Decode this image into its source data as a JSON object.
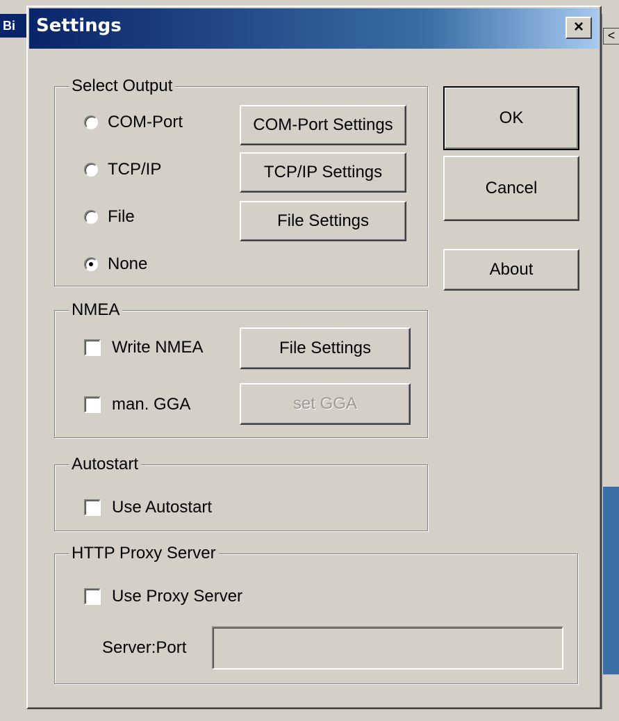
{
  "background": {
    "title_fragment": "Bi",
    "arrow": "<"
  },
  "dialog": {
    "title": "Settings",
    "close_label": "×"
  },
  "select_output": {
    "label": "Select Output",
    "options": [
      {
        "label": "COM-Port",
        "checked": false
      },
      {
        "label": "TCP/IP",
        "checked": false
      },
      {
        "label": "File",
        "checked": false
      },
      {
        "label": "None",
        "checked": true
      }
    ],
    "buttons": {
      "com_port_settings": "COM-Port Settings",
      "tcpip_settings": "TCP/IP Settings",
      "file_settings": "File Settings"
    }
  },
  "actions": {
    "ok": "OK",
    "cancel": "Cancel",
    "about": "About"
  },
  "nmea": {
    "label": "NMEA",
    "write_nmea": "Write NMEA",
    "man_gga": "man. GGA",
    "file_settings": "File Settings",
    "set_gga": "set GGA"
  },
  "autostart": {
    "label": "Autostart",
    "use_autostart": "Use Autostart"
  },
  "proxy": {
    "label": "HTTP Proxy Server",
    "use_proxy": "Use Proxy Server",
    "server_port_label": "Server:Port",
    "server_port_value": ""
  }
}
